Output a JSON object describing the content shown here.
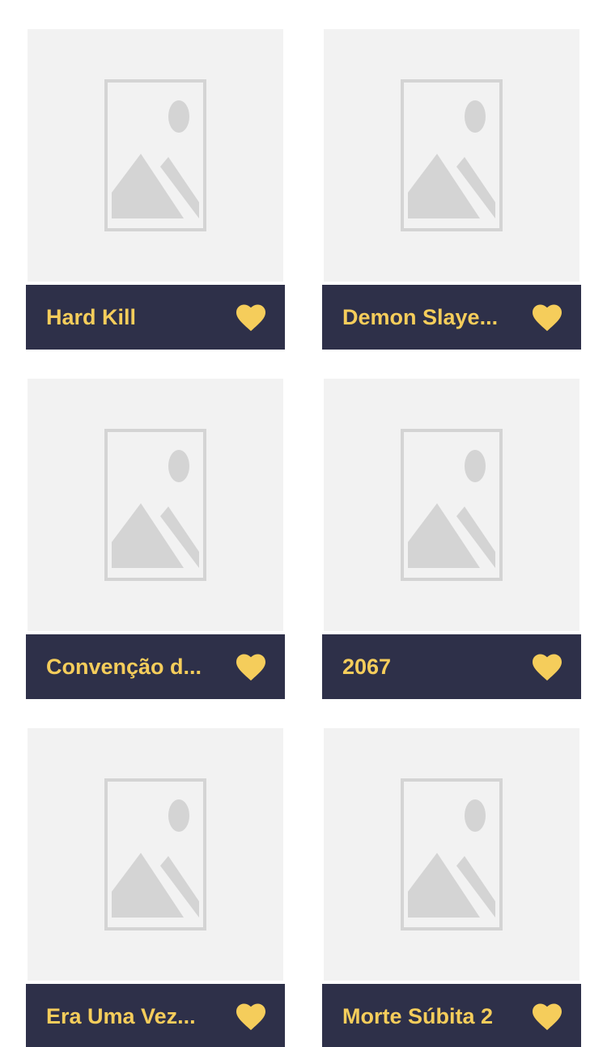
{
  "accent_color": "#f5cd5b",
  "bar_color": "#2e3049",
  "placeholder_color": "#f2f2f2",
  "movies": [
    {
      "title": "Hard Kill",
      "poster_icon": "image-placeholder-icon",
      "favorite_icon": "heart-icon"
    },
    {
      "title": "Demon Slaye...",
      "poster_icon": "image-placeholder-icon",
      "favorite_icon": "heart-icon"
    },
    {
      "title": "Convenção d...",
      "poster_icon": "image-placeholder-icon",
      "favorite_icon": "heart-icon"
    },
    {
      "title": "2067",
      "poster_icon": "image-placeholder-icon",
      "favorite_icon": "heart-icon"
    },
    {
      "title": "Era Uma Vez...",
      "poster_icon": "image-placeholder-icon",
      "favorite_icon": "heart-icon"
    },
    {
      "title": "Morte Súbita 2",
      "poster_icon": "image-placeholder-icon",
      "favorite_icon": "heart-icon"
    }
  ]
}
